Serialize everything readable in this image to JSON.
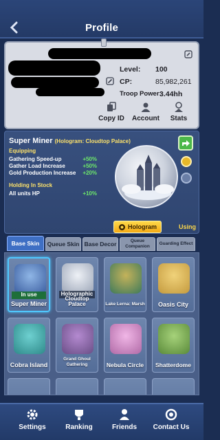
{
  "header": {
    "title": "Profile"
  },
  "profile": {
    "level_label": "Level:",
    "level_value": "100",
    "cp_label": "CP:",
    "cp_value": "85,982,261",
    "troop_label": "Troop Power:",
    "troop_value": "3.44hh",
    "actions": [
      {
        "label": "Copy ID",
        "icon": "copy-icon"
      },
      {
        "label": "Account",
        "icon": "account-icon"
      },
      {
        "label": "Stats",
        "icon": "stats-icon"
      }
    ]
  },
  "skin": {
    "name": "Super Miner",
    "subtitle": "(Hologram: Cloudtop Palace)",
    "equipping_title": "Equipping",
    "buffs": [
      {
        "label": "Gathering Speed-up",
        "value": "+50%"
      },
      {
        "label": "Gather Load Increase",
        "value": "+50%"
      },
      {
        "label": "Gold Production Increase",
        "value": "+20%"
      }
    ],
    "stock_title": "Holding In Stock",
    "stock_buffs": [
      {
        "label": "All units HP",
        "value": "+10%"
      }
    ],
    "hologram_button": "Hologram",
    "status": "Using"
  },
  "tabs": [
    {
      "label": "Base Skin",
      "active": true
    },
    {
      "label": "Queue Skin",
      "active": false
    },
    {
      "label": "Base Decor",
      "active": false
    },
    {
      "label": "Queue Companion",
      "active": false
    },
    {
      "label": "Guarding Effect",
      "active": false
    }
  ],
  "skins": [
    {
      "label": "Super Miner",
      "tag": "In use",
      "color": "#3a5c9e"
    },
    {
      "label": "Cloudtop Palace",
      "tag": "Holographic",
      "color": "#9aa4b6"
    },
    {
      "label": "Lake Lerna: Marsh",
      "tag": "",
      "color": "#3f7a5a"
    },
    {
      "label": "Oasis City",
      "tag": "",
      "color": "#c49a3e"
    },
    {
      "label": "Cobra Island",
      "tag": "",
      "color": "#2f8a8a"
    },
    {
      "label": "Grand Ghoul Gathering",
      "tag": "",
      "color": "#6a4e86"
    },
    {
      "label": "Nebula Circle",
      "tag": "",
      "color": "#b06aa6"
    },
    {
      "label": "Shatterdome",
      "tag": "",
      "color": "#5a8a3a"
    }
  ],
  "nav": [
    {
      "label": "Settings",
      "icon": "gear-icon"
    },
    {
      "label": "Ranking",
      "icon": "ranking-icon"
    },
    {
      "label": "Friends",
      "icon": "friends-icon"
    },
    {
      "label": "Contact Us",
      "icon": "headset-icon"
    }
  ]
}
